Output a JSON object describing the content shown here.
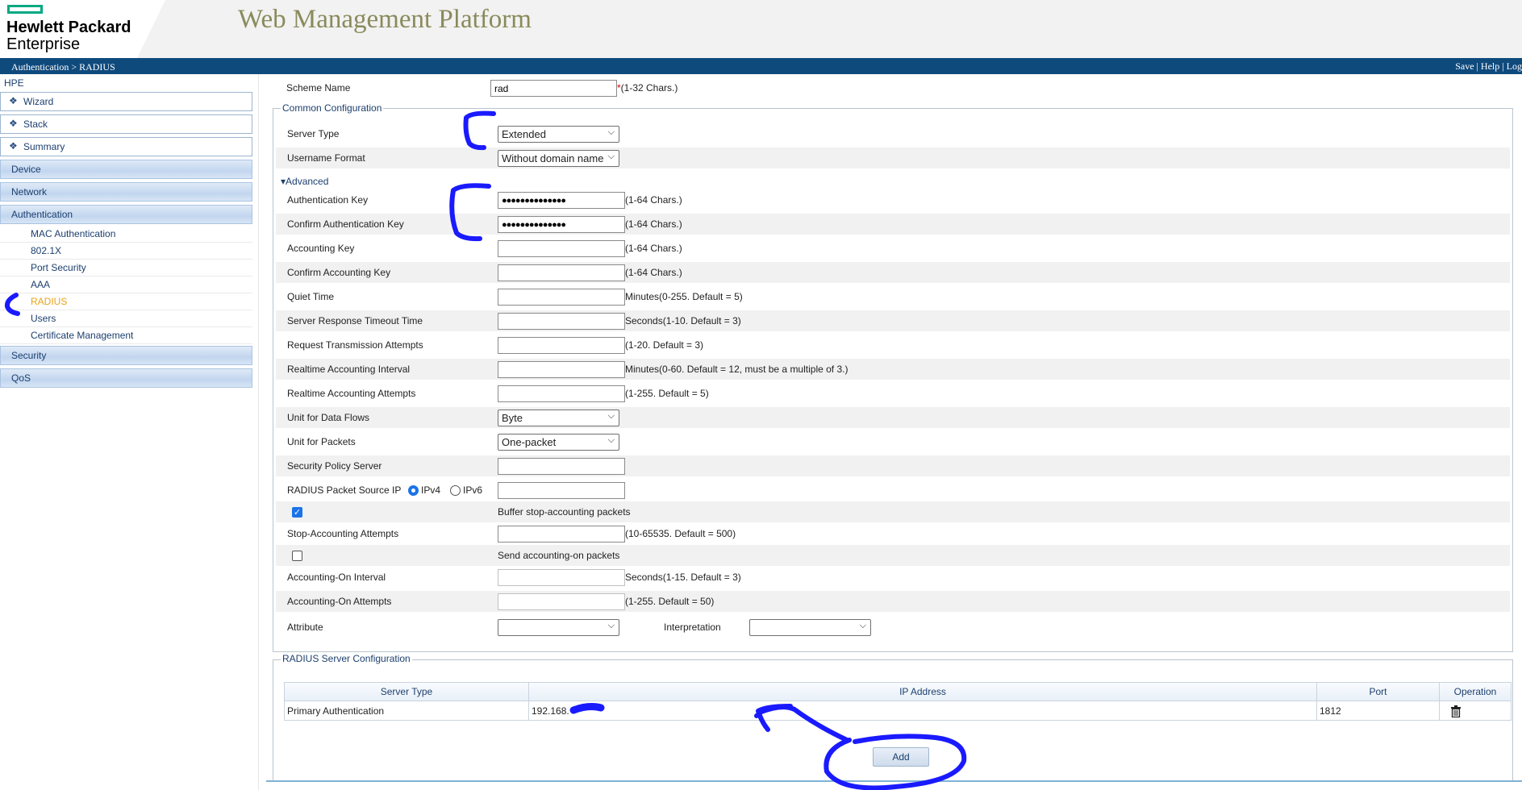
{
  "header": {
    "logo_line1": "Hewlett Packard",
    "logo_line2": "Enterprise",
    "app_title": "Web Management Platform",
    "breadcrumb": "Authentication > RADIUS",
    "links": [
      "Save",
      "Help",
      "Log"
    ]
  },
  "sidebar": {
    "root": "HPE",
    "top_items": [
      {
        "label": "Wizard",
        "icon": "diamond-icon"
      },
      {
        "label": "Stack",
        "icon": "diamond-icon"
      },
      {
        "label": "Summary",
        "icon": "diamond-icon"
      }
    ],
    "categories": [
      "Device",
      "Network",
      "Authentication"
    ],
    "auth_items": [
      "MAC Authentication",
      "802.1X",
      "Port Security",
      "AAA",
      "RADIUS",
      "Users",
      "Certificate Management"
    ],
    "active_item": "RADIUS",
    "categories_after": [
      "Security",
      "QoS"
    ]
  },
  "form": {
    "scheme_name_label": "Scheme Name",
    "scheme_name_value": "rad",
    "scheme_name_req": "*",
    "scheme_name_hint": "(1-32 Chars.)",
    "common_legend": "Common Configuration",
    "server_type_label": "Server Type",
    "server_type_value": "Extended",
    "username_format_label": "Username Format",
    "username_format_value": "Without domain name",
    "advanced_label": "Advanced",
    "auth_key_label": "Authentication Key",
    "auth_key_value": "●●●●●●●●●●●●●●",
    "auth_key_hint": "(1-64 Chars.)",
    "confirm_auth_key_label": "Confirm Authentication Key",
    "confirm_auth_key_value": "●●●●●●●●●●●●●●",
    "confirm_auth_key_hint": "(1-64 Chars.)",
    "acct_key_label": "Accounting Key",
    "acct_key_hint": "(1-64 Chars.)",
    "confirm_acct_key_label": "Confirm Accounting Key",
    "confirm_acct_key_hint": "(1-64 Chars.)",
    "quiet_time_label": "Quiet Time",
    "quiet_time_hint": "Minutes(0-255. Default = 5)",
    "timeout_label": "Server Response Timeout Time",
    "timeout_hint": "Seconds(1-10. Default = 3)",
    "retrans_label": "Request Transmission Attempts",
    "retrans_hint": "(1-20. Default = 3)",
    "rt_interval_label": "Realtime Accounting Interval",
    "rt_interval_hint": "Minutes(0-60. Default = 12, must be a multiple of 3.)",
    "rt_attempts_label": "Realtime Accounting Attempts",
    "rt_attempts_hint": "(1-255. Default = 5)",
    "data_unit_label": "Unit for Data Flows",
    "data_unit_value": "Byte",
    "packet_unit_label": "Unit for Packets",
    "packet_unit_value": "One-packet",
    "sec_policy_label": "Security Policy Server",
    "src_ip_label": "RADIUS Packet Source IP",
    "ipv4_label": "IPv4",
    "ipv6_label": "IPv6",
    "ip_version_selected": "IPv4",
    "buffer_label": "Buffer stop-accounting packets",
    "buffer_checked": true,
    "stop_attempts_label": "Stop-Accounting Attempts",
    "stop_attempts_hint": "(10-65535. Default = 500)",
    "acct_on_label": "Send accounting-on packets",
    "acct_on_checked": false,
    "acct_on_interval_label": "Accounting-On Interval",
    "acct_on_interval_hint": "Seconds(1-15. Default = 3)",
    "acct_on_attempts_label": "Accounting-On Attempts",
    "acct_on_attempts_hint": "(1-255. Default = 50)",
    "attribute_label": "Attribute",
    "interpretation_label": "Interpretation"
  },
  "servers": {
    "legend": "RADIUS Server Configuration",
    "columns": [
      "Server Type",
      "IP Address",
      "Port",
      "Operation"
    ],
    "rows": [
      {
        "type": "Primary Authentication",
        "ip": "192.168.",
        "port": "1812",
        "op_icon": "trash-icon"
      }
    ],
    "add_label": "Add"
  },
  "colors": {
    "accent": "#0f4a7d",
    "brand": "#01a982",
    "active_nav": "#e8a317",
    "annotation": "#1a1aff"
  }
}
